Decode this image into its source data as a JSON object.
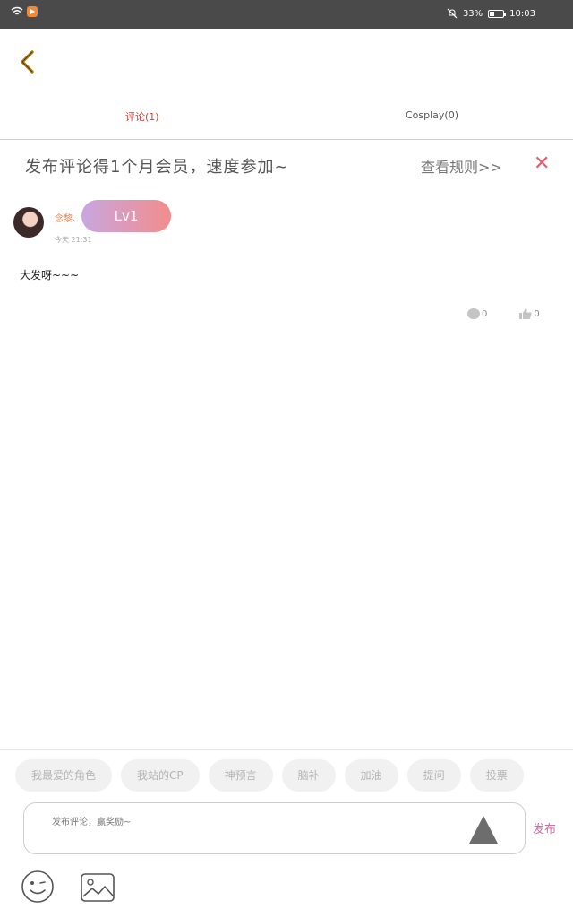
{
  "status_bar": {
    "battery_percent": "33%",
    "battery_level": 0.33,
    "time": "10:03",
    "icons": [
      "wifi-icon",
      "app-notification-icon",
      "mute-icon",
      "battery-icon"
    ]
  },
  "nav": {
    "back_icon": "chevron-left-icon"
  },
  "tabs": [
    {
      "label": "评论(1)",
      "active": true
    },
    {
      "label": "Cosplay(0)",
      "active": false
    }
  ],
  "banner": {
    "text": "发布评论得1个月会员，速度参加~",
    "link": "查看规则>>",
    "close": "✕"
  },
  "comment": {
    "username": "念黎、",
    "level": "Lv1",
    "time": "今天 21:31",
    "body": "大发呀~~~",
    "reply_count": "0",
    "like_count": "0"
  },
  "quick_tags": [
    "我最爱的角色",
    "我站的CP",
    "神预言",
    "脑补",
    "加油",
    "提问",
    "投票"
  ],
  "input": {
    "placeholder": "发布评论，赢奖励~",
    "send_label": "发布"
  },
  "colors": {
    "accent_tab": "#c8453a",
    "close": "#e65a6a",
    "publish": "#d96aa3",
    "level_gradient_start": "#c8a7e0",
    "level_gradient_end": "#f38c8c"
  }
}
